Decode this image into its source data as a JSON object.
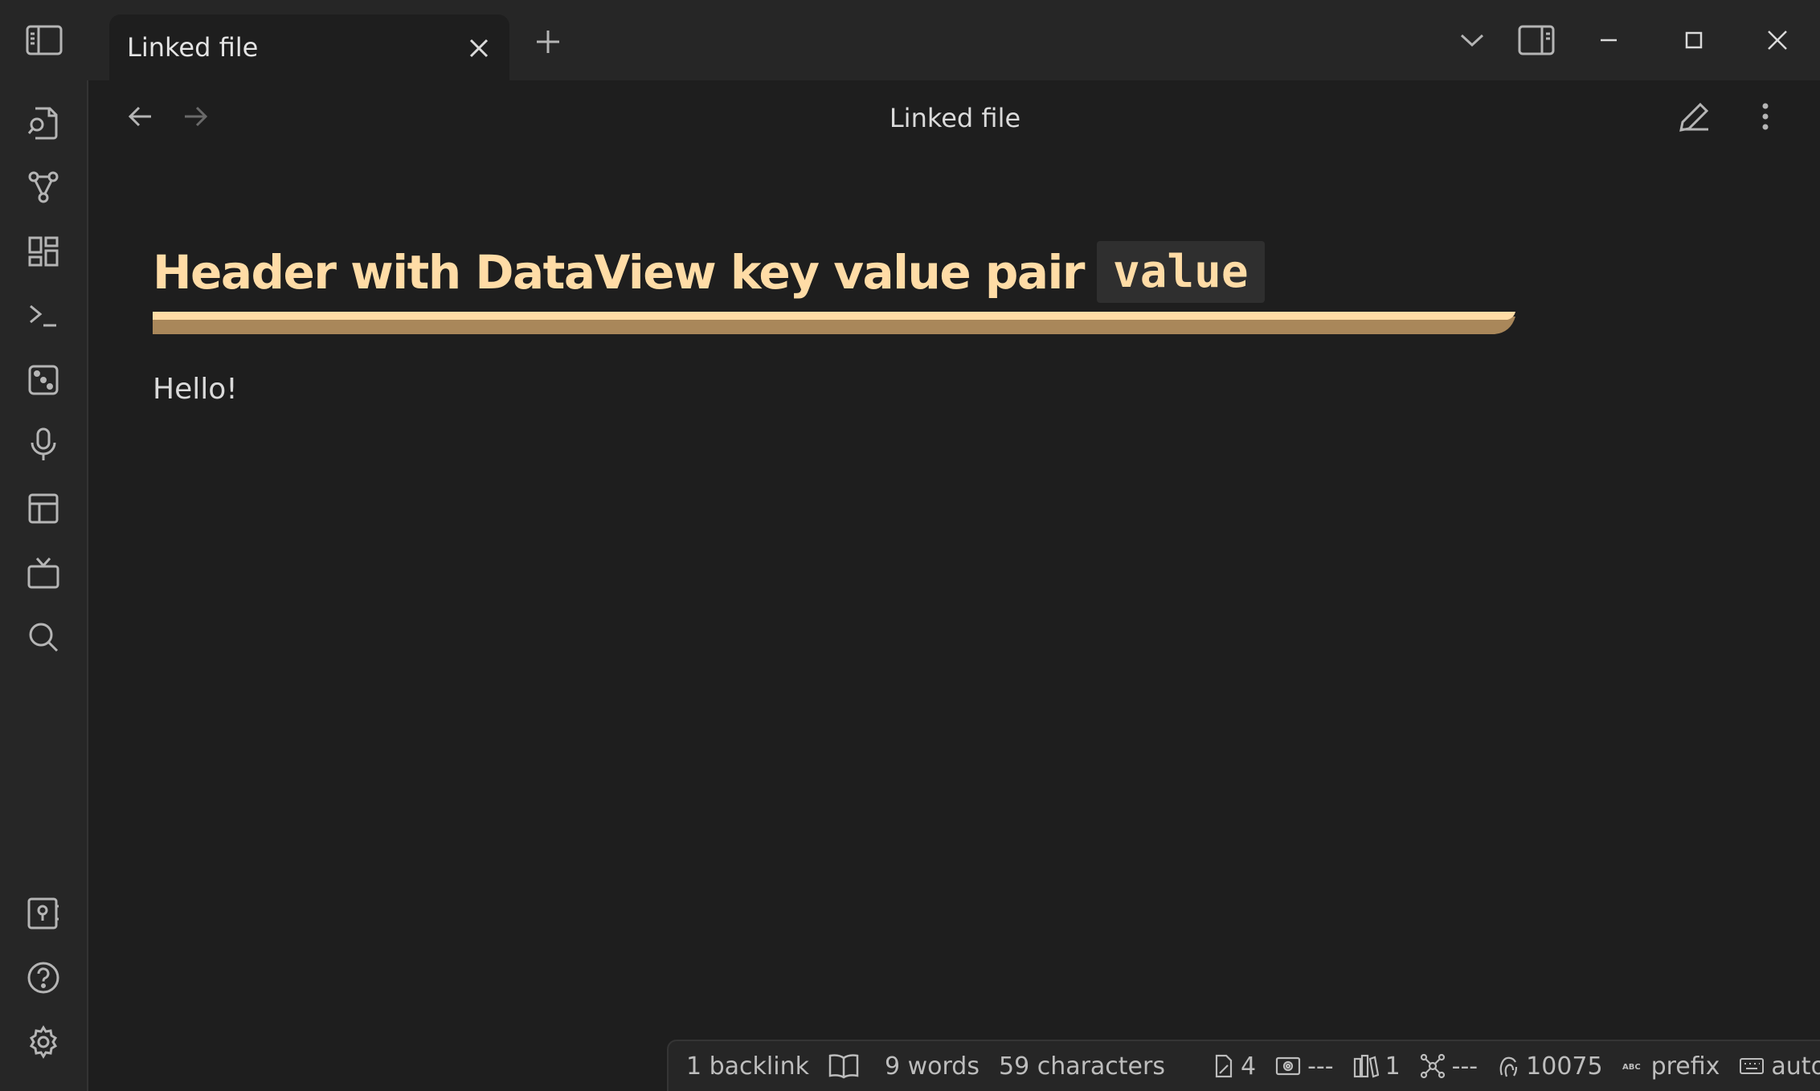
{
  "tab": {
    "title": "Linked file"
  },
  "header": {
    "title": "Linked file"
  },
  "note": {
    "heading_text": "Header with DataView key value pair",
    "heading_code": "value",
    "paragraph": "Hello!",
    "accent_color": "#ffdca6"
  },
  "ribbon": {
    "icons": [
      "open-quick-switcher-icon",
      "graph-view-icon",
      "canvas-icon",
      "command-palette-icon",
      "random-note-icon",
      "audio-recorder-icon",
      "templates-icon",
      "slides-icon",
      "search-icon"
    ],
    "bottom_icons": [
      "vault-switcher-icon",
      "help-icon",
      "settings-icon"
    ]
  },
  "status": {
    "backlinks": "1 backlink",
    "words": "9 words",
    "characters": "59 characters",
    "edits": "4",
    "s2": "---",
    "s3": "1",
    "s4": "---",
    "s5": "10075",
    "s6": "prefix",
    "s7": "auto"
  }
}
